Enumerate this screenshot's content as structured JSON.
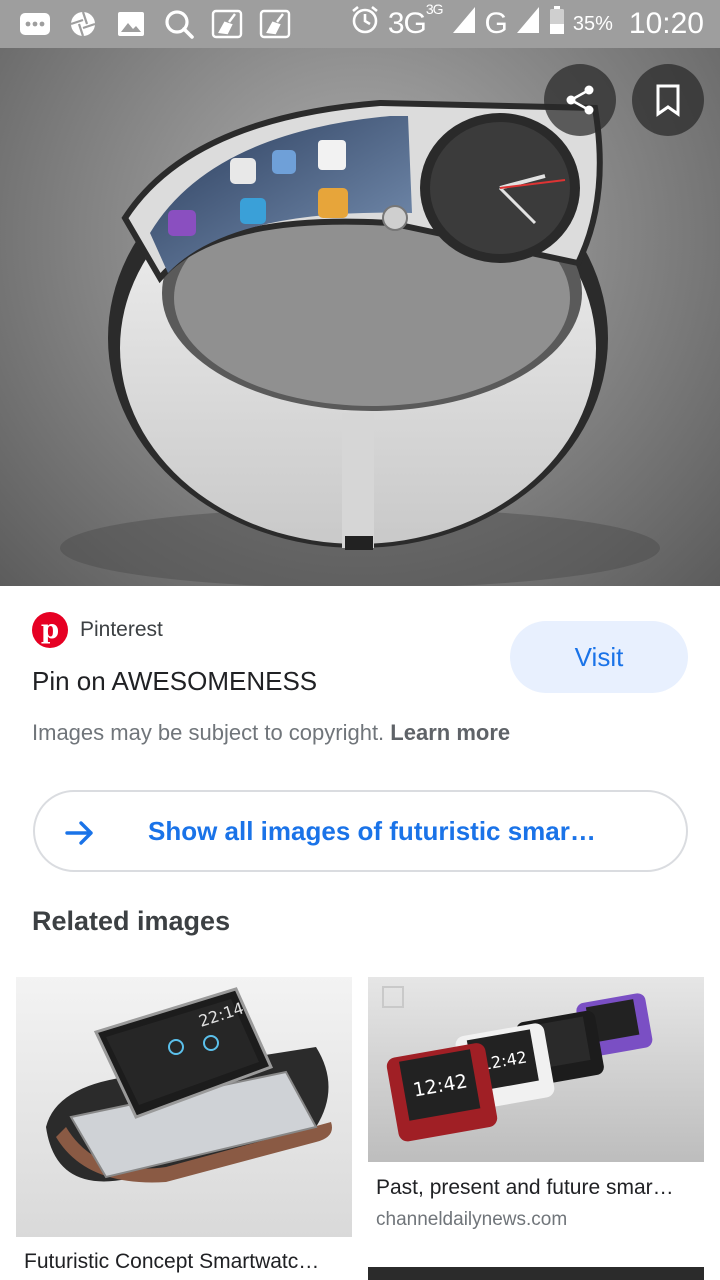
{
  "status_bar": {
    "network_primary": "3G",
    "network_sup": "3G",
    "network_secondary": "G",
    "battery": "35%",
    "time": "10:20",
    "icons": [
      "message-icon",
      "aperture-icon",
      "gallery-icon",
      "search-icon",
      "cleaner-icon",
      "cleaner-icon",
      "alarm-icon",
      "signal-icon",
      "battery-icon"
    ]
  },
  "hero": {
    "share_icon": "share-icon",
    "save_icon": "bookmark-icon"
  },
  "result": {
    "source": "Pinterest",
    "title": "Pin on AWESOMENESS",
    "visit_label": "Visit",
    "copyright_text": "Images may be subject to copyright.",
    "learn_more": "Learn more",
    "show_all_label": "Show all images of futuristic smar…"
  },
  "related": {
    "heading": "Related images",
    "items": [
      {
        "title": "Futuristic Concept Smartwatc…",
        "site": ""
      },
      {
        "title": "Past, present and future smar…",
        "site": "channeldailynews.com"
      }
    ]
  },
  "colors": {
    "accent": "#1a73e8",
    "pinterest": "#e60023",
    "visit_bg": "#e8f0fe",
    "status_bar": "#9e9e9e"
  }
}
